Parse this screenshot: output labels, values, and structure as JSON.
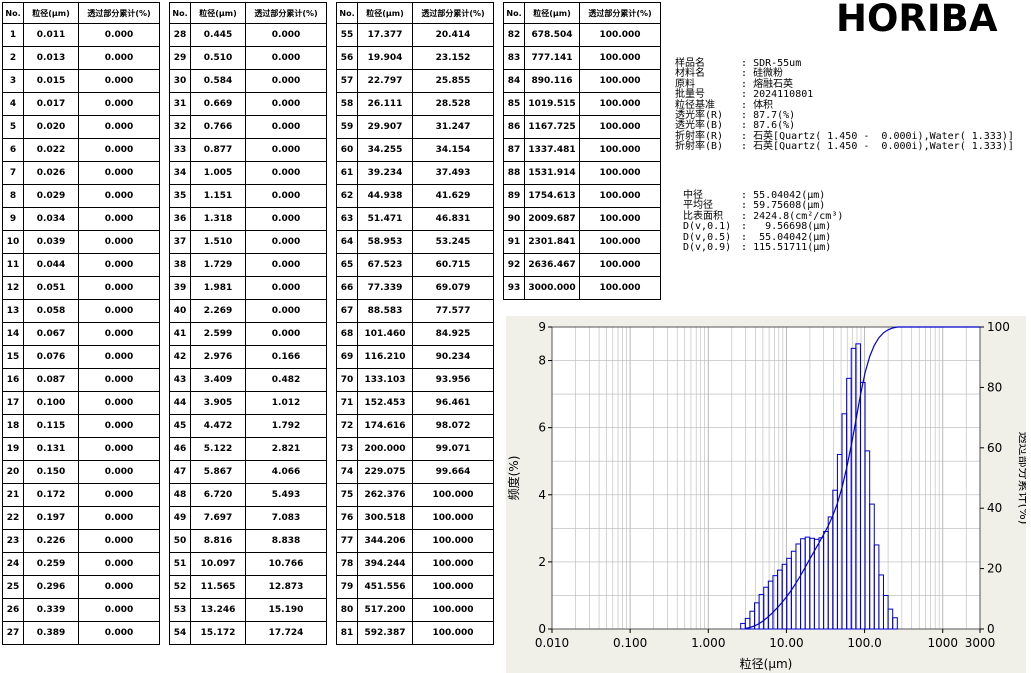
{
  "logo": "HORIBA",
  "table": {
    "headers": [
      "No.",
      "粒径(μm)",
      "透过部分累计(%)"
    ],
    "rows": [
      [
        "1",
        "0.011",
        "0.000"
      ],
      [
        "2",
        "0.013",
        "0.000"
      ],
      [
        "3",
        "0.015",
        "0.000"
      ],
      [
        "4",
        "0.017",
        "0.000"
      ],
      [
        "5",
        "0.020",
        "0.000"
      ],
      [
        "6",
        "0.022",
        "0.000"
      ],
      [
        "7",
        "0.026",
        "0.000"
      ],
      [
        "8",
        "0.029",
        "0.000"
      ],
      [
        "9",
        "0.034",
        "0.000"
      ],
      [
        "10",
        "0.039",
        "0.000"
      ],
      [
        "11",
        "0.044",
        "0.000"
      ],
      [
        "12",
        "0.051",
        "0.000"
      ],
      [
        "13",
        "0.058",
        "0.000"
      ],
      [
        "14",
        "0.067",
        "0.000"
      ],
      [
        "15",
        "0.076",
        "0.000"
      ],
      [
        "16",
        "0.087",
        "0.000"
      ],
      [
        "17",
        "0.100",
        "0.000"
      ],
      [
        "18",
        "0.115",
        "0.000"
      ],
      [
        "19",
        "0.131",
        "0.000"
      ],
      [
        "20",
        "0.150",
        "0.000"
      ],
      [
        "21",
        "0.172",
        "0.000"
      ],
      [
        "22",
        "0.197",
        "0.000"
      ],
      [
        "23",
        "0.226",
        "0.000"
      ],
      [
        "24",
        "0.259",
        "0.000"
      ],
      [
        "25",
        "0.296",
        "0.000"
      ],
      [
        "26",
        "0.339",
        "0.000"
      ],
      [
        "27",
        "0.389",
        "0.000"
      ],
      [
        "28",
        "0.445",
        "0.000"
      ],
      [
        "29",
        "0.510",
        "0.000"
      ],
      [
        "30",
        "0.584",
        "0.000"
      ],
      [
        "31",
        "0.669",
        "0.000"
      ],
      [
        "32",
        "0.766",
        "0.000"
      ],
      [
        "33",
        "0.877",
        "0.000"
      ],
      [
        "34",
        "1.005",
        "0.000"
      ],
      [
        "35",
        "1.151",
        "0.000"
      ],
      [
        "36",
        "1.318",
        "0.000"
      ],
      [
        "37",
        "1.510",
        "0.000"
      ],
      [
        "38",
        "1.729",
        "0.000"
      ],
      [
        "39",
        "1.981",
        "0.000"
      ],
      [
        "40",
        "2.269",
        "0.000"
      ],
      [
        "41",
        "2.599",
        "0.000"
      ],
      [
        "42",
        "2.976",
        "0.166"
      ],
      [
        "43",
        "3.409",
        "0.482"
      ],
      [
        "44",
        "3.905",
        "1.012"
      ],
      [
        "45",
        "4.472",
        "1.792"
      ],
      [
        "46",
        "5.122",
        "2.821"
      ],
      [
        "47",
        "5.867",
        "4.066"
      ],
      [
        "48",
        "6.720",
        "5.493"
      ],
      [
        "49",
        "7.697",
        "7.083"
      ],
      [
        "50",
        "8.816",
        "8.838"
      ],
      [
        "51",
        "10.097",
        "10.766"
      ],
      [
        "52",
        "11.565",
        "12.873"
      ],
      [
        "53",
        "13.246",
        "15.190"
      ],
      [
        "54",
        "15.172",
        "17.724"
      ],
      [
        "55",
        "17.377",
        "20.414"
      ],
      [
        "56",
        "19.904",
        "23.152"
      ],
      [
        "57",
        "22.797",
        "25.855"
      ],
      [
        "58",
        "26.111",
        "28.528"
      ],
      [
        "59",
        "29.907",
        "31.247"
      ],
      [
        "60",
        "34.255",
        "34.154"
      ],
      [
        "61",
        "39.234",
        "37.493"
      ],
      [
        "62",
        "44.938",
        "41.629"
      ],
      [
        "63",
        "51.471",
        "46.831"
      ],
      [
        "64",
        "58.953",
        "53.245"
      ],
      [
        "65",
        "67.523",
        "60.715"
      ],
      [
        "66",
        "77.339",
        "69.079"
      ],
      [
        "67",
        "88.583",
        "77.577"
      ],
      [
        "68",
        "101.460",
        "84.925"
      ],
      [
        "69",
        "116.210",
        "90.234"
      ],
      [
        "70",
        "133.103",
        "93.956"
      ],
      [
        "71",
        "152.453",
        "96.461"
      ],
      [
        "72",
        "174.616",
        "98.072"
      ],
      [
        "73",
        "200.000",
        "99.071"
      ],
      [
        "74",
        "229.075",
        "99.664"
      ],
      [
        "75",
        "262.376",
        "100.000"
      ],
      [
        "76",
        "300.518",
        "100.000"
      ],
      [
        "77",
        "344.206",
        "100.000"
      ],
      [
        "78",
        "394.244",
        "100.000"
      ],
      [
        "79",
        "451.556",
        "100.000"
      ],
      [
        "80",
        "517.200",
        "100.000"
      ],
      [
        "81",
        "592.387",
        "100.000"
      ],
      [
        "82",
        "678.504",
        "100.000"
      ],
      [
        "83",
        "777.141",
        "100.000"
      ],
      [
        "84",
        "890.116",
        "100.000"
      ],
      [
        "85",
        "1019.515",
        "100.000"
      ],
      [
        "86",
        "1167.725",
        "100.000"
      ],
      [
        "87",
        "1337.481",
        "100.000"
      ],
      [
        "88",
        "1531.914",
        "100.000"
      ],
      [
        "89",
        "1754.613",
        "100.000"
      ],
      [
        "90",
        "2009.687",
        "100.000"
      ],
      [
        "91",
        "2301.841",
        "100.000"
      ],
      [
        "92",
        "2636.467",
        "100.000"
      ],
      [
        "93",
        "3000.000",
        "100.000"
      ]
    ]
  },
  "sample_info": [
    {
      "label": "样品名",
      "value": "SDR-55um"
    },
    {
      "label": "材料名",
      "value": "硅微粉"
    },
    {
      "label": "原料",
      "value": "熔融石英"
    },
    {
      "label": "批量号",
      "value": "2024110801"
    },
    {
      "label": "粒径基准",
      "value": "体积"
    },
    {
      "label": "透光率(R)",
      "value": "87.7(%)"
    },
    {
      "label": "透光率(B)",
      "value": "87.6(%)"
    },
    {
      "label": "折射率(R)",
      "value": "石英[Quartz( 1.450 -  0.000i),Water( 1.333)]"
    },
    {
      "label": "折射率(B)",
      "value": "石英[Quartz( 1.450 -  0.000i),Water( 1.333)]"
    }
  ],
  "stats": [
    {
      "label": "中径",
      "value": "55.04042(μm)"
    },
    {
      "label": "平均径",
      "value": "59.75608(μm)"
    },
    {
      "label": "比表面积",
      "value": "2424.8(cm²/cm³)"
    },
    {
      "label": "D(v,0.1)",
      "value": "  9.56698(μm)"
    },
    {
      "label": "D(v,0.5)",
      "value": " 55.04042(μm)"
    },
    {
      "label": "D(v,0.9)",
      "value": "115.51711(μm)"
    }
  ],
  "chart_data": {
    "type": "bar",
    "xscale": "log",
    "xlim": [
      0.01,
      3000
    ],
    "x_ticks": [
      "0.010",
      "0.100",
      "1.000",
      "10.00",
      "100.0",
      "1000",
      "3000"
    ],
    "xlabel": "粒径(μm)",
    "ylabel_left": "频度(%)",
    "ylabel_right": "透过部分累计(%)",
    "ylim_left": [
      0,
      9
    ],
    "ylim_right": [
      0,
      100
    ],
    "y_ticks_left": [
      "0",
      "2",
      "4",
      "6",
      "8",
      "9"
    ],
    "y_ticks_right": [
      "0",
      "20",
      "40",
      "60",
      "80",
      "100"
    ],
    "grid": true,
    "colors": {
      "series": "#0000cc",
      "grid": "#b8b8b8",
      "background": "#f0f0e8",
      "plot": "#ffffff"
    },
    "series": [
      {
        "kind": "bars",
        "values": [
          [
            "2.976",
            "0.166"
          ],
          [
            "3.409",
            "0.316"
          ],
          [
            "3.905",
            "0.530"
          ],
          [
            "4.472",
            "0.780"
          ],
          [
            "5.122",
            "1.029"
          ],
          [
            "5.867",
            "1.245"
          ],
          [
            "6.720",
            "1.427"
          ],
          [
            "7.697",
            "1.590"
          ],
          [
            "8.816",
            "1.755"
          ],
          [
            "10.097",
            "1.928"
          ],
          [
            "11.565",
            "2.107"
          ],
          [
            "13.246",
            "2.317"
          ],
          [
            "15.172",
            "2.534"
          ],
          [
            "17.377",
            "2.690"
          ],
          [
            "19.904",
            "2.738"
          ],
          [
            "22.797",
            "2.703"
          ],
          [
            "26.111",
            "2.673"
          ],
          [
            "29.907",
            "2.719"
          ],
          [
            "34.255",
            "2.907"
          ],
          [
            "39.234",
            "3.339"
          ],
          [
            "44.938",
            "4.136"
          ],
          [
            "51.471",
            "5.202"
          ],
          [
            "58.953",
            "6.414"
          ],
          [
            "67.523",
            "7.470"
          ],
          [
            "77.339",
            "8.364"
          ],
          [
            "88.583",
            "8.498"
          ],
          [
            "101.460",
            "7.348"
          ],
          [
            "116.210",
            "5.309"
          ],
          [
            "133.103",
            "3.722"
          ],
          [
            "152.453",
            "2.505"
          ],
          [
            "174.616",
            "1.611"
          ],
          [
            "200.000",
            "0.999"
          ],
          [
            "229.075",
            "0.593"
          ],
          [
            "262.376",
            "0.336"
          ]
        ]
      },
      {
        "kind": "cumulative",
        "source": "table"
      }
    ]
  }
}
